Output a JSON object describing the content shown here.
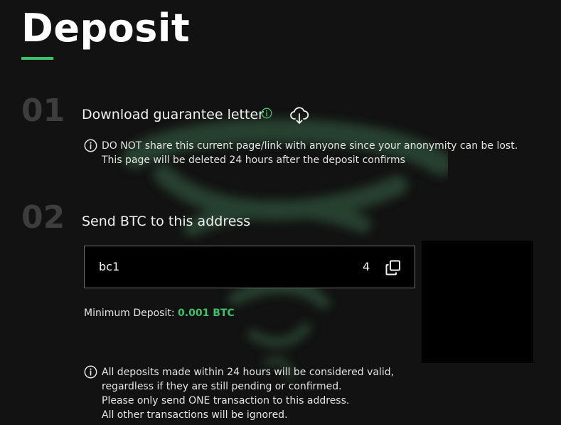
{
  "page": {
    "title": "Deposit",
    "accent_color": "#3fc06b",
    "step_number_color": "#3d3d3d"
  },
  "steps": [
    {
      "number": "01",
      "title": "Download guarantee letter",
      "icons": [
        "info-icon",
        "cloud-download-icon"
      ],
      "note_lines": [
        "DO NOT share this current page/link with anyone since your anonymity can be lost.",
        "This page will be deleted 24 hours after the deposit confirms"
      ]
    },
    {
      "number": "02",
      "title": "Send BTC to this address",
      "address": {
        "start": "bc1",
        "end": "4",
        "copy_icon": "copy-icon"
      },
      "min_deposit": {
        "label": "Minimum Deposit:",
        "amount": "0.001 BTC"
      },
      "note_lines": [
        "All deposits made within 24 hours will be considered valid,",
        "regardless if they are still pending or confirmed.",
        "Please only send ONE transaction to this address.",
        "All other transactions will be ignored."
      ]
    }
  ]
}
